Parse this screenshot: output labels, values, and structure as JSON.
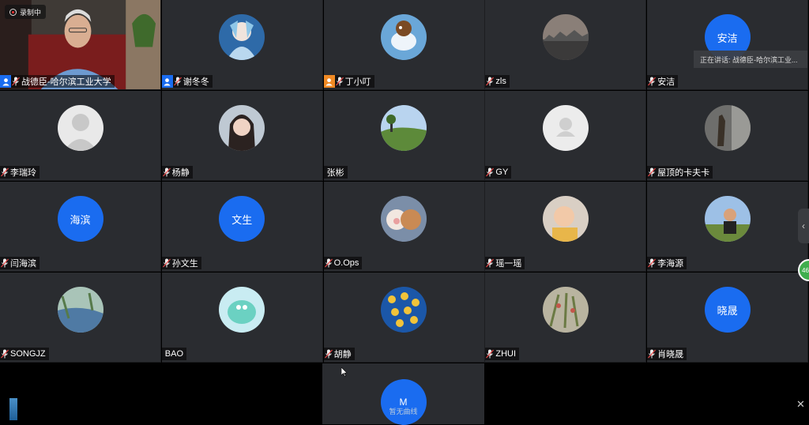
{
  "recording_label": "录制中",
  "speaking_label": "正在讲话: 战德臣-哈尔滨工业...",
  "green_badge": "46",
  "colors": {
    "accent_blue": "#1a6cf0",
    "tile_bg": "#2a2c30",
    "orange": "#f08a24"
  },
  "participants": [
    {
      "name": "战德臣-哈尔滨工业大学",
      "badge": "host",
      "mic": true,
      "avatar": "video"
    },
    {
      "name": "谢冬冬",
      "badge": "host",
      "mic": true,
      "avatar": "anime"
    },
    {
      "name": "丁小叮",
      "badge": "orange",
      "mic": true,
      "avatar": "bird"
    },
    {
      "name": "zls",
      "mic": true,
      "avatar": "city"
    },
    {
      "name": "安洁",
      "mic": true,
      "avatar": "text",
      "text": "安洁"
    },
    {
      "name": "李瑞玲",
      "mic": true,
      "avatar": "default_person"
    },
    {
      "name": "杨静",
      "mic": true,
      "avatar": "girl"
    },
    {
      "name": "张彬",
      "mic": false,
      "avatar": "landscape"
    },
    {
      "name": "GY",
      "mic": true,
      "avatar": "default_white"
    },
    {
      "name": "屋顶的卡夫卡",
      "mic": true,
      "avatar": "dark_photo"
    },
    {
      "name": "闫海滨",
      "mic": true,
      "avatar": "text",
      "text": "海滨"
    },
    {
      "name": "孙文生",
      "mic": true,
      "avatar": "text",
      "text": "文生"
    },
    {
      "name": "O.Ops",
      "mic": true,
      "avatar": "plush"
    },
    {
      "name": "瑶一瑶",
      "mic": true,
      "avatar": "baby"
    },
    {
      "name": "李海源",
      "mic": true,
      "avatar": "man_outdoor"
    },
    {
      "name": "SONGJZ",
      "mic": true,
      "avatar": "painting"
    },
    {
      "name": "BAO",
      "mic": false,
      "avatar": "cartoon"
    },
    {
      "name": "胡静",
      "mic": true,
      "avatar": "leaves"
    },
    {
      "name": "ZHUI",
      "mic": true,
      "avatar": "plants"
    },
    {
      "name": "肖晓晟",
      "mic": true,
      "avatar": "text",
      "text": "晓晟"
    }
  ],
  "bottom": {
    "avatar_text": "M",
    "caption": "暂无曲线"
  }
}
